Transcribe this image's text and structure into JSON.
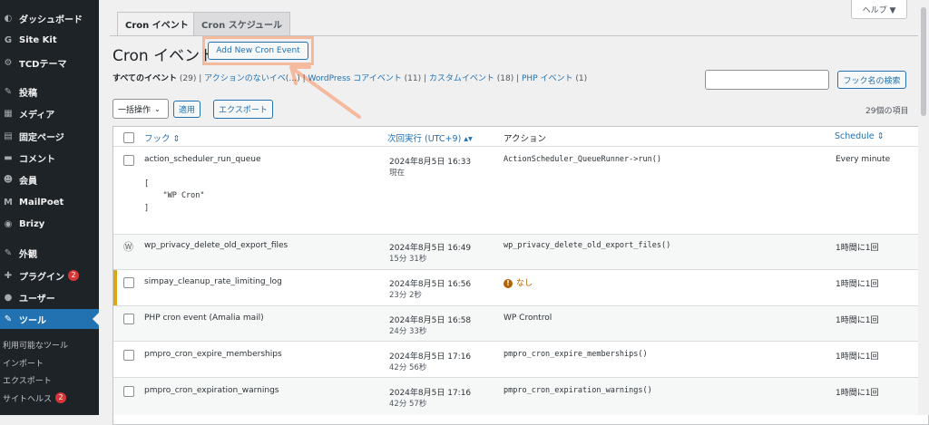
{
  "sidebar": {
    "items": [
      {
        "icon": "dashboard-icon",
        "glyph": "◐",
        "label": "ダッシュボード"
      },
      {
        "icon": "sitekit-icon",
        "glyph": "G",
        "label": "Site Kit"
      },
      {
        "icon": "tcd-icon",
        "glyph": "⚙",
        "label": "TCDテーマ"
      },
      {
        "icon": "posts-icon",
        "glyph": "✎",
        "label": "投稿"
      },
      {
        "icon": "media-icon",
        "glyph": "▦",
        "label": "メディア"
      },
      {
        "icon": "pages-icon",
        "glyph": "▤",
        "label": "固定ページ"
      },
      {
        "icon": "comments-icon",
        "glyph": "▬",
        "label": "コメント"
      },
      {
        "icon": "members-icon",
        "glyph": "☻",
        "label": "会員"
      },
      {
        "icon": "mailpoet-icon",
        "glyph": "M",
        "label": "MailPoet"
      },
      {
        "icon": "brizy-icon",
        "glyph": "◉",
        "label": "Brizy"
      },
      {
        "icon": "appearance-icon",
        "glyph": "✎",
        "label": "外観"
      },
      {
        "icon": "plugins-icon",
        "glyph": "✚",
        "label": "プラグイン",
        "badge": "2"
      },
      {
        "icon": "users-icon",
        "glyph": "●",
        "label": "ユーザー"
      },
      {
        "icon": "tools-icon",
        "glyph": "✎",
        "label": "ツール"
      }
    ],
    "sub_items": [
      {
        "label": "利用可能なツール"
      },
      {
        "label": "インポート"
      },
      {
        "label": "エクスポート"
      },
      {
        "label": "サイトヘルス",
        "badge": "2"
      }
    ]
  },
  "tabs": [
    "Cron イベント",
    "Cron スケジュール"
  ],
  "help_label": "ヘルプ ▼",
  "page_title": "Cron イベント",
  "add_button": "Add New Cron Event",
  "filters": {
    "all": "すべてのイベント",
    "all_count": "(29)",
    "noaction": "アクションのないイベ",
    "noaction_count": "(…)",
    "core": "WordPress コアイベント",
    "core_count": "(11)",
    "custom": "カスタムイベント",
    "custom_count": "(18)",
    "php": "PHP イベント",
    "php_count": "(1)"
  },
  "search_button": "フック名の検索",
  "bulk_select": "一括操作",
  "apply_button": "適用",
  "export_button": "エクスポート",
  "item_count": "29個の項目",
  "columns": {
    "hook": "フック ⇕",
    "next": "次回実行 (UTC+9) ▴▾",
    "action": "アクション",
    "schedule": "Schedule ⇕"
  },
  "rows": [
    {
      "hook": "action_scheduler_run_queue",
      "args": [
        "[",
        "    \"WP Cron\"",
        "]"
      ],
      "next": "2024年8月5日 16:33",
      "rel": "現在",
      "action": "ActionScheduler_QueueRunner->run()",
      "schedule": "Every minute"
    },
    {
      "hook": "wp_privacy_delete_old_export_files",
      "next": "2024年8月5日 16:49",
      "rel": "15分 31秒",
      "action": "wp_privacy_delete_old_export_files()",
      "schedule": "1時間に1回"
    },
    {
      "hook": "simpay_cleanup_rate_limiting_log",
      "next": "2024年8月5日 16:56",
      "rel": "23分 2秒",
      "action": "なし",
      "schedule": "1時間に1回"
    },
    {
      "hook": "PHP cron event (Amalia mail)",
      "next": "2024年8月5日 16:58",
      "rel": "24分 33秒",
      "action": "WP Crontrol",
      "schedule": "1時間に1回"
    },
    {
      "hook": "pmpro_cron_expire_memberships",
      "next": "2024年8月5日 17:16",
      "rel": "42分 56秒",
      "action": "pmpro_cron_expire_memberships()",
      "schedule": "1時間に1回"
    },
    {
      "hook": "pmpro_cron_expiration_warnings",
      "next": "2024年8月5日 17:16",
      "rel": "42分 57秒",
      "action": "pmpro_cron_expiration_warnings()",
      "schedule": "1時間に1回"
    }
  ],
  "colors": {
    "sidebar": "#1d2327",
    "accent": "#2271b1",
    "highlight": "#f5b99e",
    "warning": "#dba617"
  }
}
